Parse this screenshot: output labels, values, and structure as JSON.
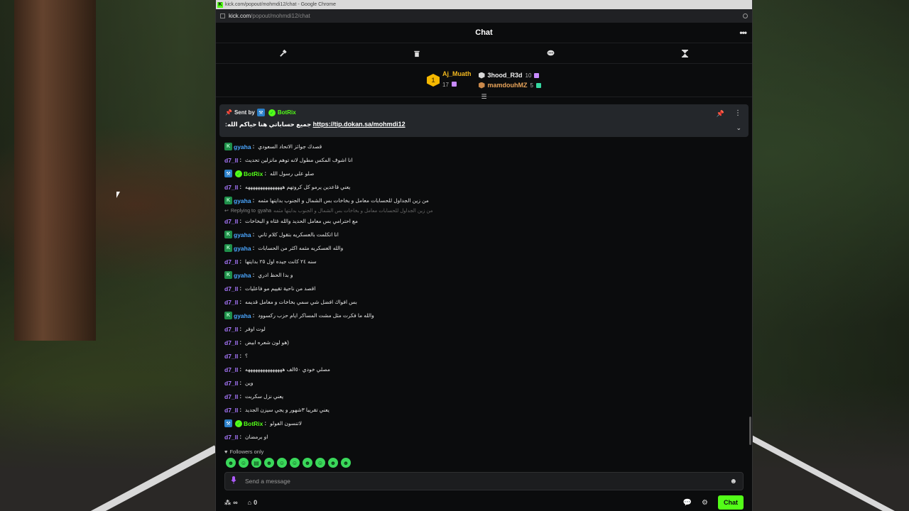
{
  "browser": {
    "window_title": "kick.com/popout/mohmdi12/chat - Google Chrome",
    "url_host": "kick.com",
    "url_path": "/popout/mohmdi12/chat"
  },
  "chat": {
    "title": "Chat",
    "more_icon": "more-horizontal-icon"
  },
  "mod_tools": [
    {
      "name": "hammer-icon",
      "glyph": "🔨"
    },
    {
      "name": "trash-icon",
      "glyph": "🗑"
    },
    {
      "name": "speech-bubble-icon",
      "glyph": "💬"
    },
    {
      "name": "hourglass-icon",
      "glyph": "⧗"
    }
  ],
  "leaderboard": {
    "first": {
      "rank": "1",
      "name": "Aj_Muath",
      "count": "17"
    },
    "second": {
      "name": "3hood_R3d",
      "count": "10"
    },
    "third": {
      "name": "mamdouhMZ",
      "count": "5"
    }
  },
  "pinned": {
    "sent_by_label": "Sent by",
    "bot_name": "BotRix",
    "message_text": "جميع حساباتي هنا حياكم الله:",
    "link": "https://tip.dokan.sa/mohmdi12"
  },
  "messages": [
    {
      "user": "gyaha",
      "type": "gyaha",
      "text": "قصدك جوائز الاتحاد السعودي"
    },
    {
      "user": "d7_ll",
      "type": "d7",
      "text": "انا اشوف المكس مطول لانه توهم مانزلين تحديث"
    },
    {
      "user": "BotRix",
      "type": "bot",
      "text": "صلو على رسول الله"
    },
    {
      "user": "d7_ll",
      "type": "d7",
      "text": "يعني قاعدين يرمو كل كروتهم هههههههههههههههه"
    },
    {
      "user": "gyaha",
      "type": "gyaha",
      "text": "من زين الجداول للحسابات معامل و بخاخات بس الشمال و الجنوب بدايتها مثمه"
    },
    {
      "user": "d7_ll",
      "type": "d7",
      "text": "مع احترامي بس معامل الحديد والله غثاه و البخاخات",
      "reply_to": "gyaha",
      "reply_quote": "من زين الجداول للحسابات معامل و بخاخات بس الشمال و الجنوب بدايتها مثمه",
      "reply_label": "Replying to"
    },
    {
      "user": "gyaha",
      "type": "gyaha",
      "text": "انا اتكلمت بالعسكريه بتقول كلام ثاني"
    },
    {
      "user": "gyaha",
      "type": "gyaha",
      "text": "والله العسكريه مثمه اكثر من الحسابات"
    },
    {
      "user": "d7_ll",
      "type": "d7",
      "text": "سنه ٢٤ كانت جيده اول ٢٥ بدايتها"
    },
    {
      "user": "gyaha",
      "type": "gyaha",
      "text": "و بدا الحظ ادري"
    },
    {
      "user": "d7_ll",
      "type": "d7",
      "text": "اقصد من ناحية تقييم مو فاعليات"
    },
    {
      "user": "d7_ll",
      "type": "d7",
      "text": "بس افواك افضل شي سمي بخاخات و معامل قديمه"
    },
    {
      "user": "gyaha",
      "type": "gyaha",
      "text": "والله ما فكرت مثل مشت المساكر ايام حزب ركسوود"
    },
    {
      "user": "d7_ll",
      "type": "d7",
      "text": "لوت اوفر"
    },
    {
      "user": "d7_ll",
      "type": "d7",
      "text": "(هو لون شعره ابيض"
    },
    {
      "user": "d7_ll",
      "type": "d7",
      "text": "؟"
    },
    {
      "user": "d7_ll",
      "type": "d7",
      "text": "مصلي خودي ٥٠الف هههههههههههههههه"
    },
    {
      "user": "d7_ll",
      "type": "d7",
      "text": "وين"
    },
    {
      "user": "d7_ll",
      "type": "d7",
      "text": "يعني نزل سكربت"
    },
    {
      "user": "d7_ll",
      "type": "d7",
      "text": "يعني تقريبا ٣شهور و يجي سيزن الجديد"
    },
    {
      "user": "BotRix",
      "type": "bot",
      "text": "لاتنسون الفولو"
    },
    {
      "user": "d7_ll",
      "type": "d7",
      "text": "او برمضان"
    }
  ],
  "footer": {
    "followers_only": "Followers only",
    "emotes": [
      "emote-1",
      "emote-2",
      "emote-3",
      "emote-4",
      "emote-5",
      "emote-6",
      "emote-7",
      "emote-8",
      "emote-9",
      "emote-10"
    ],
    "input_placeholder": "Send a message",
    "viewer_glyph": "∞",
    "points_count": "0",
    "chat_button": "Chat"
  },
  "colors": {
    "kick_green": "#53fc18",
    "gyaha_color": "#4aa6ff",
    "d7_color": "#a977ff",
    "gold": "#f5b800"
  }
}
